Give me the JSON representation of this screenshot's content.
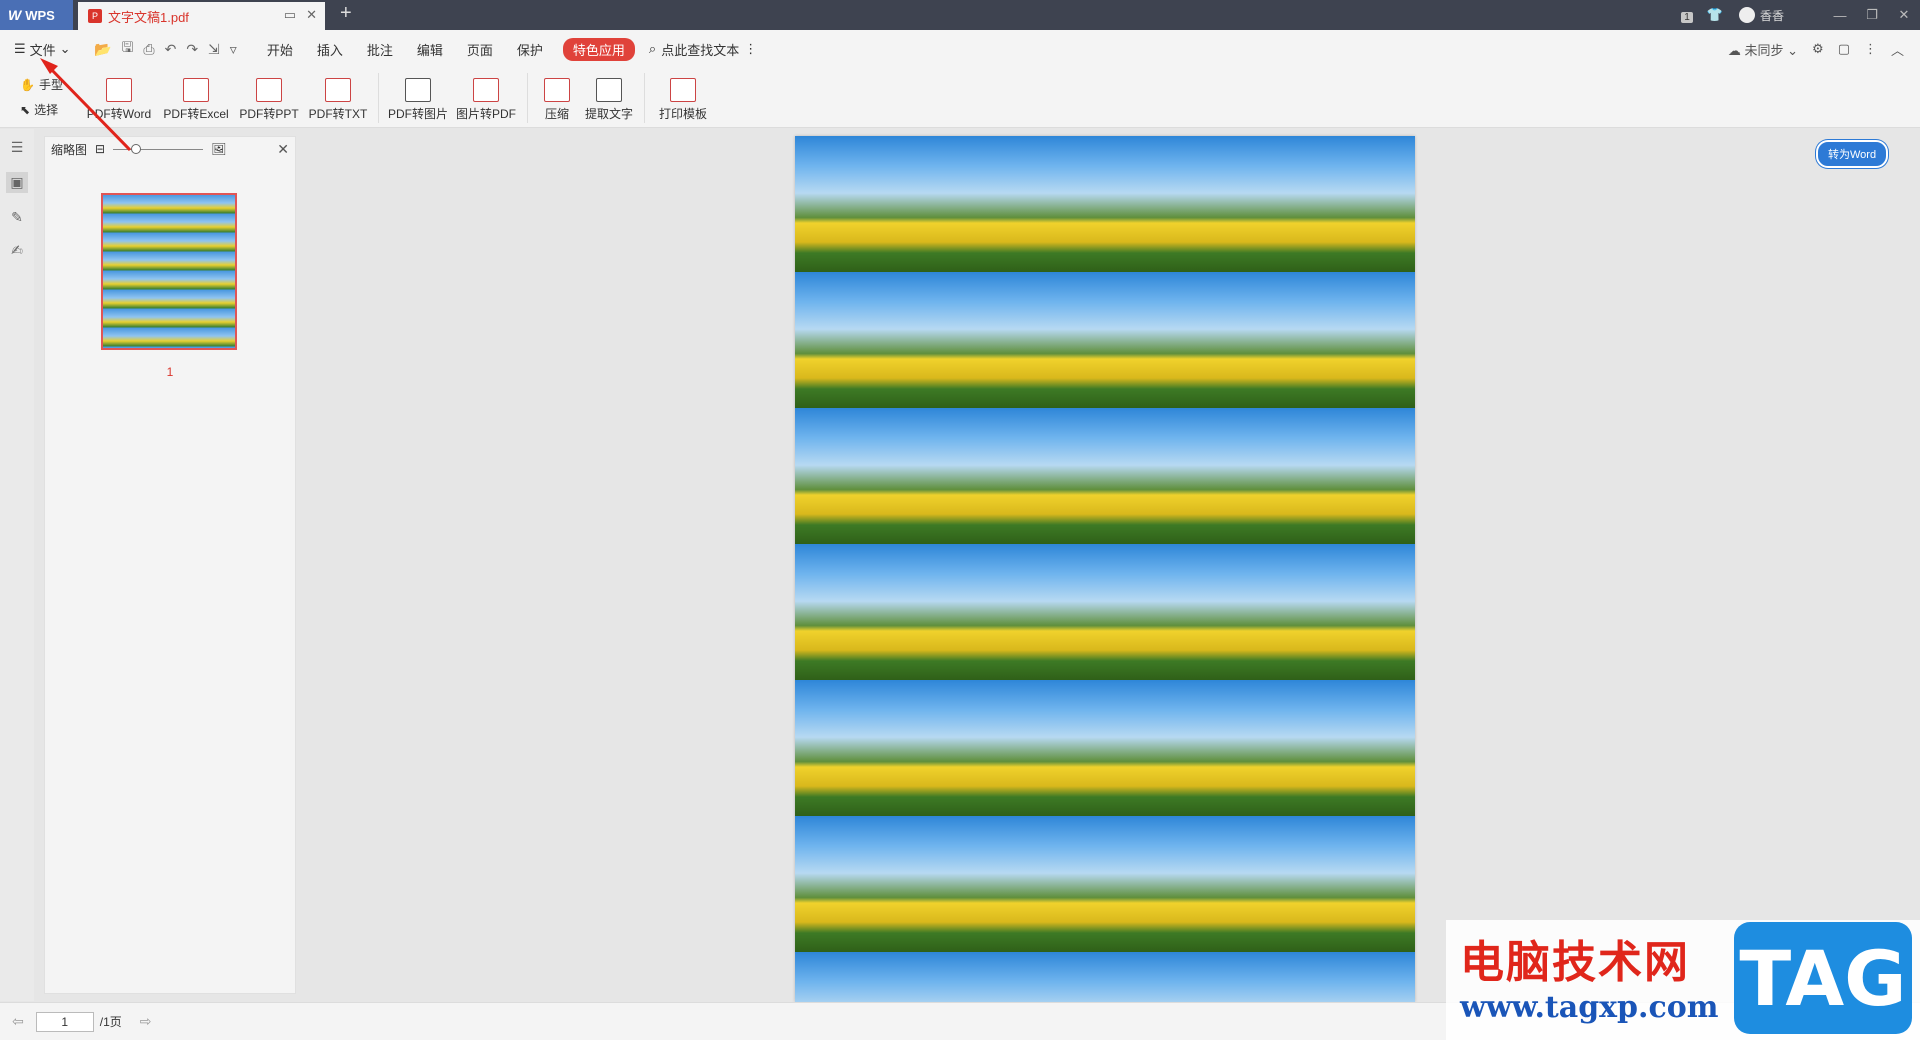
{
  "titlebar": {
    "app_name": "WPS",
    "doc_tab": "文字文稿1.pdf",
    "badge": "1",
    "user_name": "香香"
  },
  "menubar": {
    "file": "文件",
    "items": [
      "开始",
      "插入",
      "批注",
      "编辑",
      "页面",
      "保护"
    ],
    "special": "特色应用",
    "search": "点此查找文本",
    "sync": "未同步"
  },
  "ribbon": {
    "hand": "手型",
    "select": "选择",
    "buttons": [
      "PDF转Word",
      "PDF转Excel",
      "PDF转PPT",
      "PDF转TXT",
      "PDF转图片",
      "图片转PDF",
      "压缩",
      "提取文字",
      "打印模板"
    ]
  },
  "thumbnail": {
    "title": "缩略图",
    "page_number": "1",
    "zoom_fraction": 0.2
  },
  "document": {
    "to_word": "转为Word"
  },
  "statusbar": {
    "current_page": "1",
    "total": "/1页"
  },
  "watermark": {
    "site_name": "电脑技术网",
    "url": "www.tagxp.com",
    "tag": "TAG"
  },
  "colors": {
    "accent_red": "#d9342b",
    "special_bg": "#e0423a",
    "to_word_blue": "#2d7ad6"
  }
}
